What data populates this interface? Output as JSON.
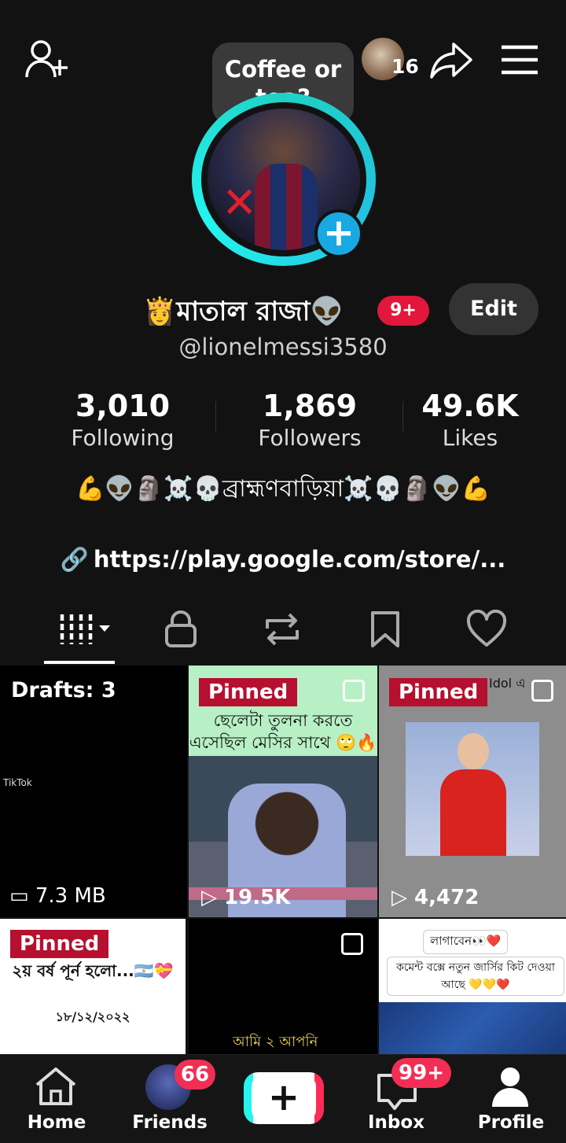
{
  "top_bar": {
    "coffee_prompt": "Coffee or tea?",
    "notification_count": "16"
  },
  "profile": {
    "nickname": "👸মাতাল রাজা👽",
    "badge": "9+",
    "edit_label": "Edit",
    "username": "@lionelmessi3580",
    "stats": [
      {
        "value": "3,010",
        "label": "Following"
      },
      {
        "value": "1,869",
        "label": "Followers"
      },
      {
        "value": "49.6K",
        "label": "Likes"
      }
    ],
    "bio": "💪👽🗿☠️💀ব্রাহ্মণবাড়িয়া☠️💀🗿👽💪",
    "link": "https://play.google.com/store/..."
  },
  "grid": {
    "drafts_label": "Drafts: 3",
    "drafts_size": "7.3 MB",
    "tiktok_mark": "TikTok",
    "pinned_label": "Pinned",
    "video2_caption": "ছেলেটা তুলনা করতে এসেছিল মেসির সাথে 🙄🔥",
    "video2_views": "19.5K",
    "video3_top": "Idol এ",
    "video3_views": "4,472",
    "video4_caption": "২য় বর্ষ পূর্ন হলো...🇦🇷💝",
    "video4_date": "১৮/১২/২০২২",
    "video5_caption": "আমি ২ আপনি",
    "video6_line1": "লাগাবেন👀❤️",
    "video6_line2": "কমেন্ট বক্সে নতুন জার্সির কিট দেওয়া আছে 💛💛❤️"
  },
  "bottom_nav": {
    "home": "Home",
    "friends": "Friends",
    "friends_badge": "66",
    "inbox": "Inbox",
    "inbox_badge": "99+",
    "profile": "Profile"
  },
  "colors": {
    "background": "#121212",
    "accent_red": "#e1183c",
    "ring_cyan": "#25f4ee",
    "pinned_red": "#b5102f"
  }
}
